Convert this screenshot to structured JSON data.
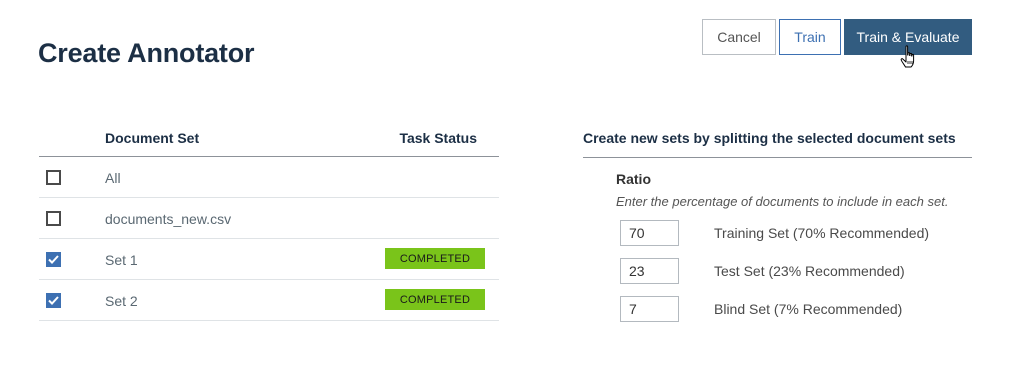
{
  "header": {
    "title": "Create Annotator",
    "buttons": {
      "cancel": "Cancel",
      "train": "Train",
      "train_evaluate": "Train & Evaluate"
    }
  },
  "document_table": {
    "columns": {
      "document_set": "Document Set",
      "task_status": "Task Status"
    },
    "rows": [
      {
        "label": "All",
        "checked": false,
        "status": ""
      },
      {
        "label": "documents_new.csv",
        "checked": false,
        "status": ""
      },
      {
        "label": "Set 1",
        "checked": true,
        "status": "COMPLETED"
      },
      {
        "label": "Set 2",
        "checked": true,
        "status": "COMPLETED"
      }
    ]
  },
  "split_panel": {
    "heading": "Create new sets by splitting the selected document sets",
    "ratio_label": "Ratio",
    "help_text": "Enter the percentage of documents to include in each set.",
    "sets": [
      {
        "value": "70",
        "label": "Training Set  (70% Recommended)"
      },
      {
        "value": "23",
        "label": "Test Set  (23% Recommended)"
      },
      {
        "value": "7",
        "label": "Blind Set  (7% Recommended)"
      }
    ]
  },
  "colors": {
    "primary": "#325c80",
    "accent_blue": "#3d70b2",
    "completed_green": "#7ac41a",
    "title": "#1c2f45"
  },
  "icons": {
    "cursor": "hand-pointer-icon",
    "check": "checkmark-icon"
  }
}
